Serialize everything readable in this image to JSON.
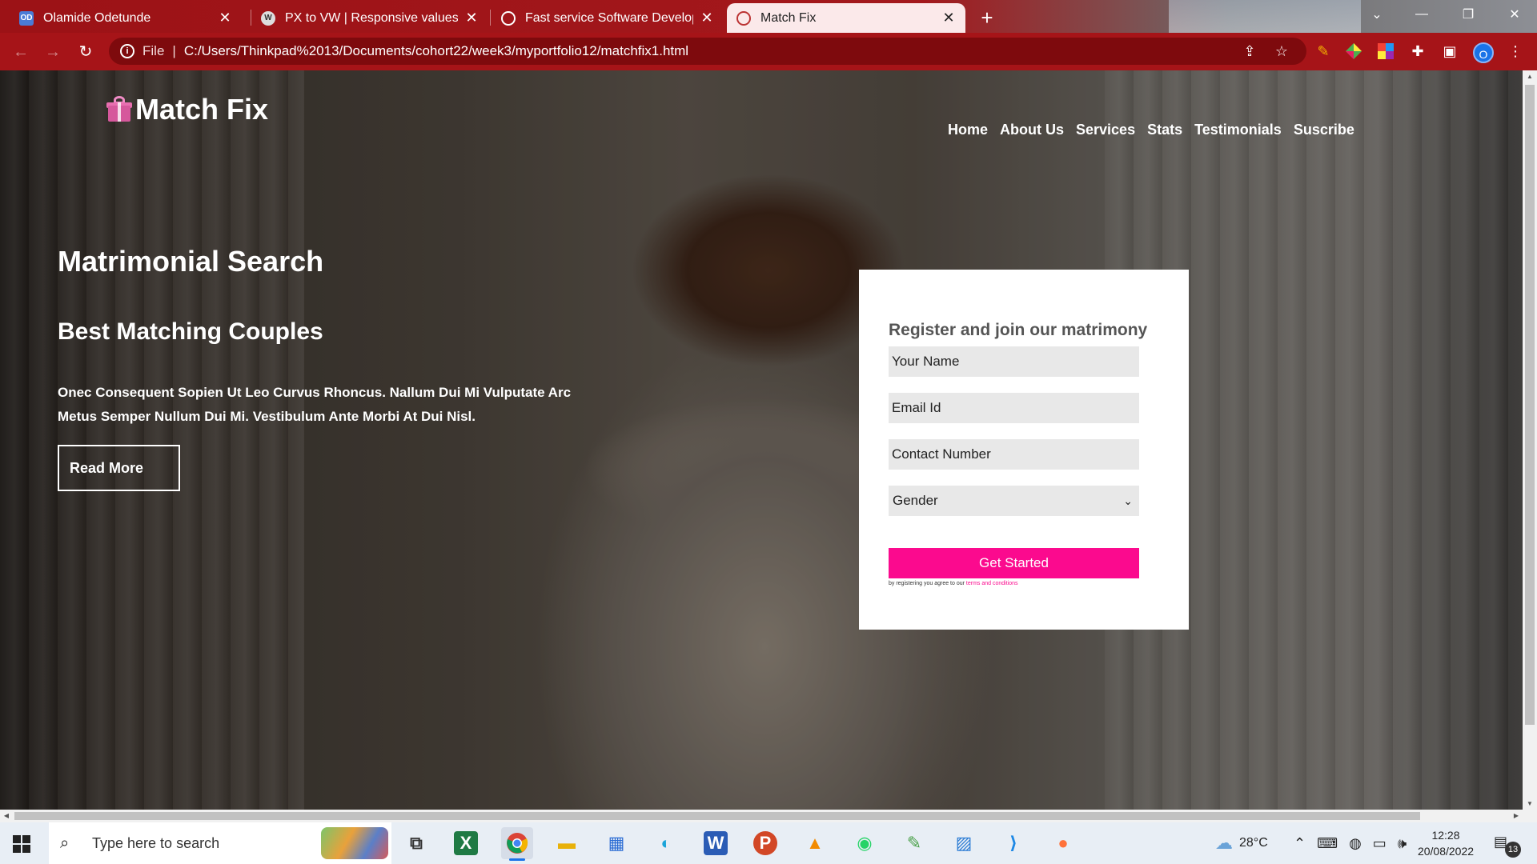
{
  "browser": {
    "tabs": [
      {
        "title": "Olamide Odetunde",
        "favicon": "od-favicon",
        "active": false
      },
      {
        "title": "PX to VW | Responsive values Co",
        "favicon": "wordpress-favicon",
        "active": false
      },
      {
        "title": "Fast service Software Developing",
        "favicon": "globe-favicon",
        "active": false
      },
      {
        "title": "Match Fix",
        "favicon": "globe-favicon",
        "active": true
      }
    ],
    "new_tab": "+",
    "address": {
      "scheme": "File",
      "url": "C:/Users/Thinkpad%2013/Documents/cohort22/week3/myportfolio12/matchfix1.html"
    },
    "profile_initial": "O"
  },
  "page": {
    "logo_text": "Match Fix",
    "nav": [
      "Home",
      "About Us",
      "Services",
      "Stats",
      "Testimonials",
      "Suscribe"
    ],
    "hero": {
      "title": "Matrimonial Search",
      "subtitle": "Best Matching Couples",
      "body": "Onec Consequent Sopien Ut Leo Curvus Rhoncus. Nallum Dui Mi Vulputate Arc Metus Semper Nullum Dui Mi. Vestibulum Ante Morbi At Dui Nisl.",
      "button": "Read More"
    },
    "form": {
      "title": "Register and join our matrimony",
      "name_placeholder": "Your Name",
      "email_placeholder": "Email Id",
      "contact_placeholder": "Contact Number",
      "gender_selected": "Gender",
      "submit": "Get Started",
      "terms_prefix": "by registering you agree to our",
      "terms_link": "terms and conditions"
    }
  },
  "taskbar": {
    "search_placeholder": "Type here to search",
    "weather": "28°C",
    "time": "12:28",
    "date": "20/08/2022",
    "notifications": "13"
  },
  "colors": {
    "accent": "#fb0a8e",
    "browser_frame": "#a61418"
  }
}
